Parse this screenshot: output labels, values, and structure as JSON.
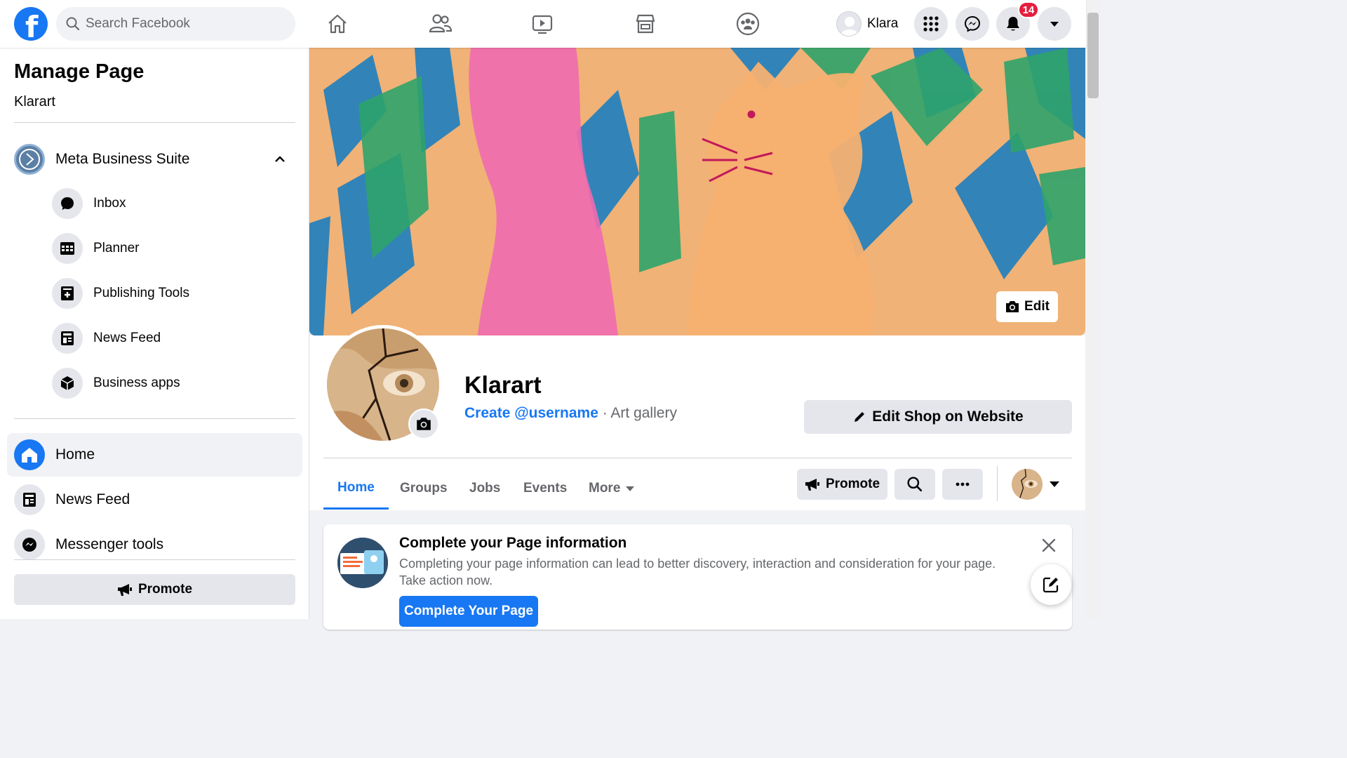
{
  "topbar": {
    "search_placeholder": "Search Facebook",
    "profile_name": "Klara",
    "notification_count": "14",
    "brand_color": "#1877f2",
    "nav_icons": [
      "home-icon",
      "friends-icon",
      "watch-icon",
      "marketplace-icon",
      "groups-icon"
    ]
  },
  "sidebar": {
    "title": "Manage Page",
    "page_name": "Klarart",
    "business_suite": {
      "label": "Meta Business Suite",
      "items": [
        {
          "label": "Inbox",
          "icon": "chat-bubble-icon"
        },
        {
          "label": "Planner",
          "icon": "calendar-grid-icon"
        },
        {
          "label": "Publishing Tools",
          "icon": "publishing-tools-icon"
        },
        {
          "label": "News Feed",
          "icon": "news-feed-icon"
        },
        {
          "label": "Business apps",
          "icon": "cube-icon"
        }
      ]
    },
    "nav": [
      {
        "label": "Home",
        "icon": "home-icon",
        "active": true
      },
      {
        "label": "News Feed",
        "icon": "news-feed-icon"
      },
      {
        "label": "Messenger tools",
        "icon": "messenger-icon"
      }
    ],
    "promote_label": "Promote"
  },
  "page": {
    "name": "Klarart",
    "create_username": "Create @username",
    "category": " · Art gallery",
    "edit_cover_label": "Edit",
    "edit_shop_label": "Edit Shop on Website",
    "tabs": [
      {
        "label": "Home",
        "active": true
      },
      {
        "label": "Groups"
      },
      {
        "label": "Jobs"
      },
      {
        "label": "Events"
      },
      {
        "label": "More"
      }
    ],
    "promote_label": "Promote"
  },
  "info_card": {
    "title": "Complete your Page information",
    "text": "Completing your page information can lead to better discovery, interaction and consideration for your page. Take action now.",
    "button": "Complete Your Page"
  }
}
